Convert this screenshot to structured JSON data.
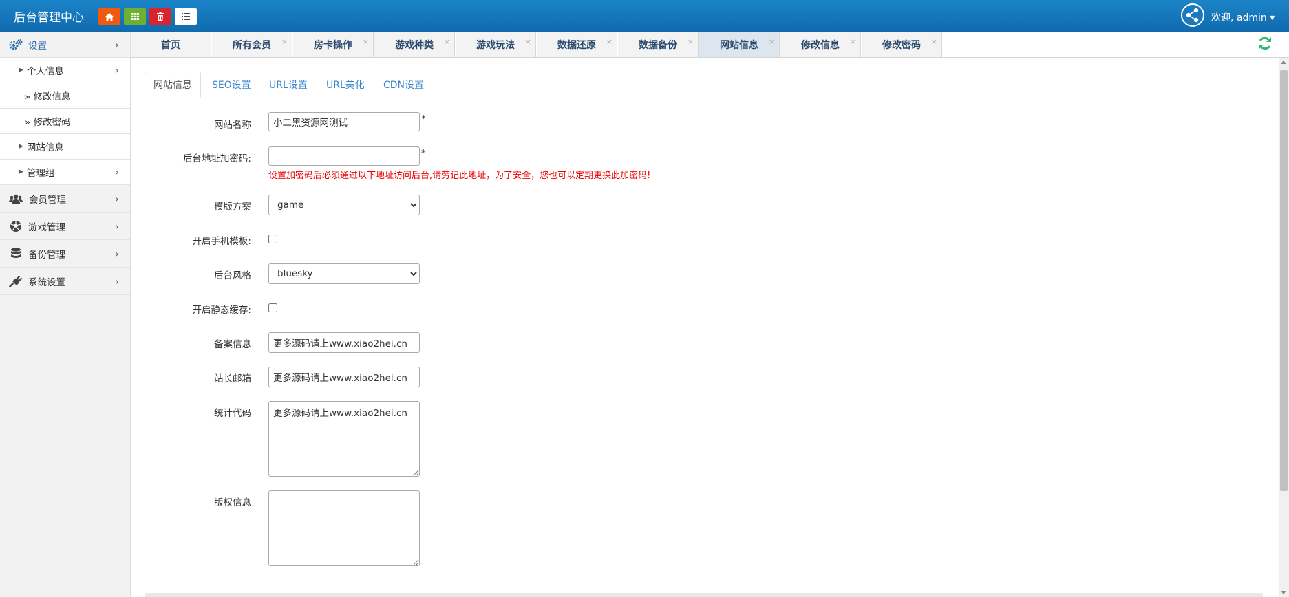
{
  "header": {
    "brand": "后台管理中心",
    "quick_buttons": [
      {
        "icon": "home-icon",
        "color": "#f05a0e"
      },
      {
        "icon": "grid-icon",
        "color": "#6eb132"
      },
      {
        "icon": "trash-icon",
        "color": "#d9232d"
      },
      {
        "icon": "list-icon",
        "color": "#ffffff"
      }
    ],
    "user_welcome": "欢迎, admin ▾"
  },
  "sidebar": {
    "items": [
      {
        "label": "设置",
        "icon": "gears-icon",
        "active": true
      },
      {
        "label": "个人信息"
      },
      {
        "label": "» 修改信息"
      },
      {
        "label": "» 修改密码"
      },
      {
        "label": "网站信息"
      },
      {
        "label": "管理组"
      },
      {
        "label": "会员管理",
        "icon": "users-icon"
      },
      {
        "label": "游戏管理",
        "icon": "soccer-icon"
      },
      {
        "label": "备份管理",
        "icon": "database-icon"
      },
      {
        "label": "系统设置",
        "icon": "plug-icon"
      }
    ]
  },
  "tabs": [
    {
      "label": "首页"
    },
    {
      "label": "所有会员"
    },
    {
      "label": "房卡操作"
    },
    {
      "label": "游戏种类"
    },
    {
      "label": "游戏玩法"
    },
    {
      "label": "数据还原"
    },
    {
      "label": "数据备份"
    },
    {
      "label": "网站信息",
      "active": true
    },
    {
      "label": "修改信息"
    },
    {
      "label": "修改密码"
    }
  ],
  "close_glyph": "×",
  "subtabs": [
    {
      "label": "网站信息",
      "active": true
    },
    {
      "label": "SEO设置"
    },
    {
      "label": "URL设置"
    },
    {
      "label": "URL美化"
    },
    {
      "label": "CDN设置"
    }
  ],
  "form": {
    "site_name": {
      "label": "网站名称",
      "value": "小二黑资源网测试"
    },
    "admin_password": {
      "label": "后台地址加密码:",
      "value": "",
      "hint": "设置加密码后必须通过以下地址访问后台,请劳记此地址，为了安全，您也可以定期更换此加密码!"
    },
    "template": {
      "label": "模版方案",
      "value": "game"
    },
    "mobile_template": {
      "label": "开启手机模板:",
      "checked": false
    },
    "admin_style": {
      "label": "后台风格",
      "value": "bluesky"
    },
    "static_cache": {
      "label": "开启静态缓存:",
      "checked": false
    },
    "icp": {
      "label": "备案信息",
      "value": "更多源码请上www.xiao2hei.cn"
    },
    "email": {
      "label": "站长邮箱",
      "value": "更多源码请上www.xiao2hei.cn"
    },
    "stats_code": {
      "label": "统计代码",
      "value": "更多源码请上www.xiao2hei.cn"
    },
    "copyright": {
      "label": "版权信息",
      "value": ""
    },
    "required_mark": "*"
  }
}
